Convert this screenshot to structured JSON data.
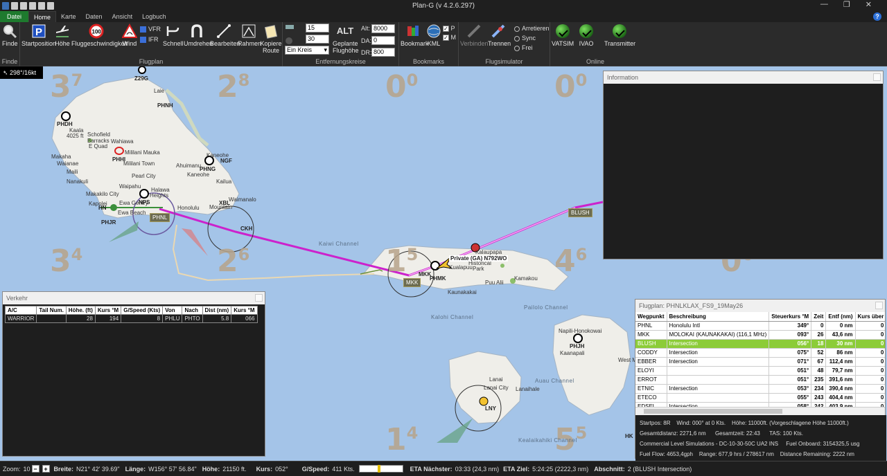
{
  "window": {
    "title": "Plan-G (v 4.2.6.297)"
  },
  "tabs": [
    "Datei",
    "Home",
    "Karte",
    "Daten",
    "Ansicht",
    "Logbuch"
  ],
  "ribbon": {
    "groups": {
      "finde": "Finde",
      "flugplan": "Flugplan",
      "entfernung": "Entfernungskreise",
      "bookmarks": "Bookmarks",
      "flugsimulator": "Flugsimulator",
      "online": "Online"
    },
    "buttons": {
      "finde": "Finde",
      "startposition": "Startposition",
      "hoehe": "Höhe",
      "fluggeschwindigkeit": "Fluggeschwindigkeit",
      "wind": "Wind",
      "vfr": "VFR",
      "ifr": "IFR",
      "schnell": "Schnell",
      "umdrehen": "Umdrehen",
      "bearbeiten": "Bearbeiten",
      "rahmen": "Rahmen",
      "kopiere_route_1": "Kopiere",
      "kopiere_route_2": "Route",
      "geplante_1": "Geplante",
      "geplante_2": "Flughöhe",
      "alt_icon_text": "ALT",
      "bookmark": "Bookmark",
      "kml": "KML",
      "p": "P",
      "m": "M",
      "verbinden": "Verbinden",
      "trennen": "Trennen",
      "arretieren": "Arretieren",
      "sync": "Sync",
      "frei": "Frei",
      "vatsim": "VATSIM",
      "ivao": "IVAO",
      "transmitter": "Transmitter"
    },
    "range_inputs": {
      "r1": "15",
      "r2": "30",
      "mode": "Ein Kreis"
    },
    "alt_fields": {
      "alt_label": "Alt:",
      "alt": "8000",
      "da_label": "DA:",
      "da": "0",
      "dr_label": "DR:",
      "dr": "800"
    }
  },
  "map": {
    "wind": "298°/16kt",
    "sectors": [
      {
        "main": "3",
        "sup": "7"
      },
      {
        "main": "2",
        "sup": "8"
      },
      {
        "main": "0",
        "sup": "0"
      },
      {
        "main": "0",
        "sup": "0"
      },
      {
        "main": "3",
        "sup": "4"
      },
      {
        "main": "2",
        "sup": "6"
      },
      {
        "main": "1",
        "sup": "5"
      },
      {
        "main": "4",
        "sup": "6"
      },
      {
        "main": "1",
        "sup": "4"
      },
      {
        "main": "5",
        "sup": "5"
      },
      {
        "main": "0",
        "sup": "6"
      }
    ],
    "labels": {
      "z29g": "Z29G",
      "laie": "Laie",
      "phnh": "PHNH",
      "phdh": "PHDH",
      "kaala": "Kaala",
      "kaala_ft": "4025 ft",
      "schofield": "Schofield",
      "barracks": "Barracks",
      "efield": "E Quad",
      "wahiawa": "Wahiawa",
      "mililani": "Mililani Mauka",
      "phhi": "PHHI",
      "mililani_town": "Mililani Town",
      "makaha": "Makaha",
      "waianae": "Waianae",
      "maili": "Maili",
      "nanakuli": "Nanakuli",
      "ahuimanu": "Ahuimanu",
      "phng": "PHNG",
      "kaneohe": "Kaneohe",
      "ngf": "NGF",
      "kaneohe_bay": "Kaneohe",
      "pearl_city": "Pearl City",
      "waipahu": "Waipahu",
      "halawa": "Halawa",
      "heights": "Heights",
      "kailua": "Kailua",
      "makakilo": "Makakilo City",
      "kapolei": "Kapolei",
      "ewa_gentry": "Ewa Gentry",
      "hn": "HN",
      "nps": "NPS",
      "honolulu": "Honolulu",
      "ewa_beach": "Ewa Beach",
      "phjr": "PHJR",
      "waimanalo": "Waimanalo",
      "xbl": "XBL",
      "mountain": "Mountain",
      "phnl": "PHNL",
      "ckh": "CKH",
      "kaiwi": "Kaiwi Channel",
      "kalohi": "Kalohi Channel",
      "pailolo": "Pailolo Channel",
      "auau": "Auau Channel",
      "kealaikahiki": "Kealaikahiki Channel",
      "mkk_tag": "MKK",
      "mkk": "MKK",
      "phmk": "PHMK",
      "kualapuu": "Kualapuu",
      "kaunakakai": "Kaunakakai",
      "puu_alii": "Puu Alii",
      "kamakou": "Kamakou",
      "historical": "Historical",
      "park": "Park",
      "kalaupapa": "Kalaupapa",
      "napili": "Napili-Honokowai",
      "phjh": "PHJH",
      "kaanapali": "Kaanapali",
      "lanai": "Lanai",
      "lanai_city": "Lanai City",
      "lanaihale": "Lanaihale",
      "lny": "LNY",
      "blush": "BLUSH",
      "aircraft": "Private (GA) N792WO",
      "west_maui": "West Maui",
      "hk": "HK"
    }
  },
  "info_panel": {
    "title": "Information"
  },
  "verkehr": {
    "title": "Verkehr",
    "columns": [
      "A/C",
      "Tail Num.",
      "Höhe. (ft)",
      "Kurs °M",
      "G/Speed (Kts)",
      "Von",
      "Nach",
      "Dist (nm)",
      "Kurs °M"
    ],
    "rows": [
      [
        "WARRIOR",
        "",
        "28",
        "194",
        "8",
        "PHLU",
        "PHTO",
        "5.8",
        "066"
      ]
    ]
  },
  "flugplan": {
    "title": "Flugplan: PHNLKLAX_FS9_19May26",
    "columns": [
      "Wegpunkt",
      "Beschreibung",
      "Steuerkurs °M",
      "Zeit",
      "Entf (nm)",
      "Kurs über"
    ],
    "rows": [
      [
        "PHNL",
        "Honolulu Intl",
        "349°",
        "0",
        "0 nm",
        "0"
      ],
      [
        "MKK",
        "MOLOKAI (KAUNAKAKAI) (116,1 MHz)",
        "093°",
        "26",
        "43,6 nm",
        "0"
      ],
      [
        "BLUSH",
        "Intersection",
        "056°",
        "18",
        "30 nm",
        "0"
      ],
      [
        "CODDY",
        "Intersection",
        "075°",
        "52",
        "86 nm",
        "0"
      ],
      [
        "EBBER",
        "Intersection",
        "071°",
        "67",
        "112,4 nm",
        "0"
      ],
      [
        "ELOYI",
        "",
        "051°",
        "48",
        "79,7 nm",
        "0"
      ],
      [
        "ERROT",
        "",
        "051°",
        "235",
        "391,6 nm",
        "0"
      ],
      [
        "ETNIC",
        "Intersection",
        "053°",
        "234",
        "390,4 nm",
        "0"
      ],
      [
        "ETECO",
        "",
        "055°",
        "243",
        "404,4 nm",
        "0"
      ],
      [
        "EDSEL",
        "Intersection",
        "058°",
        "242",
        "403,9 nm",
        "0"
      ]
    ],
    "selected_index": 2,
    "info": {
      "l1a": "Startpos: 8R",
      "l1b": "Wind: 000° at 0 Kts.",
      "l1c": "Höhe: 11000ft. (Vorgeschlagene Höhe 11000ft.)",
      "l2a": "Gesamtdistanz: 2271,6 nm",
      "l2b": "Gesamtzeit: 22:43",
      "l2c": "TAS: 100 Kts.",
      "l3a": "Commercial Level Simulations - DC-10-30-50C UA2 INS",
      "l3b": "Fuel Onboard: 3154325,5 usg",
      "l4a": "Fuel Flow: 4653,4gph",
      "l4b": "Range: 677,9 hrs / 278617 nm",
      "l4c": "Distance Remaining: 2222 nm"
    }
  },
  "statusbar": {
    "zoom_label": "Zoom:",
    "zoom": "10",
    "breite_label": "Breite:",
    "breite": "N21° 42' 39.69\"",
    "laenge_label": "Länge:",
    "laenge": "W156° 57' 56.84\"",
    "hoehe_label": "Höhe:",
    "hoehe": "21150 ft.",
    "kurs_label": "Kurs:",
    "kurs": "052°",
    "gspeed_label": "G/Speed:",
    "gspeed": "411 Kts.",
    "eta_naechster_label": "ETA Nächster:",
    "eta_naechster": "03:33 (24,3 nm)",
    "eta_ziel_label": "ETA Ziel:",
    "eta_ziel": "5:24:25 (2222,3 nm)",
    "abschnitt_label": "Abschnitt:",
    "abschnitt": "2 (BLUSH Intersection)",
    "sim_rate": 0.45
  }
}
